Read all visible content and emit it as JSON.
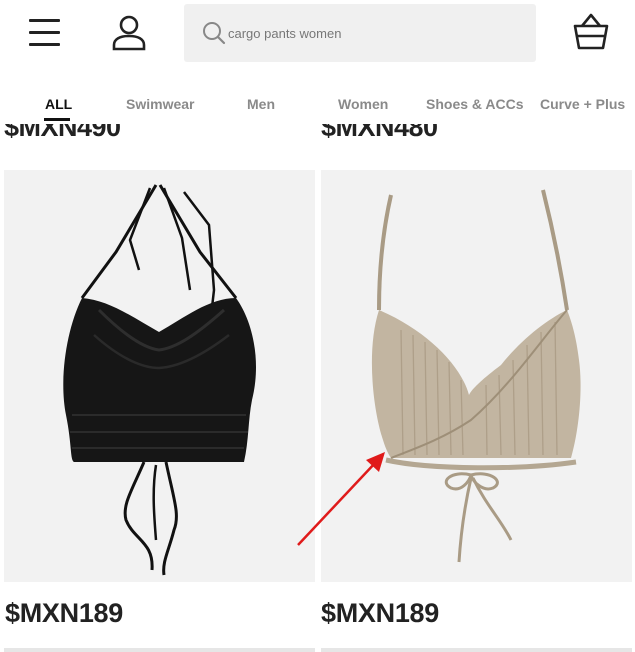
{
  "search": {
    "placeholder": "cargo pants women"
  },
  "tabs": [
    {
      "label": "ALL",
      "active": true
    },
    {
      "label": "Swimwear"
    },
    {
      "label": "Men"
    },
    {
      "label": "Women"
    },
    {
      "label": "Shoes & ACCs"
    },
    {
      "label": "Curve + Plus"
    }
  ],
  "previous_row": {
    "left_price": "$MXN490",
    "right_price": "$MXN480"
  },
  "products": [
    {
      "price": "$MXN189",
      "color": "#111111"
    },
    {
      "price": "$MXN189",
      "color": "#b6a893"
    }
  ],
  "colors": {
    "annotation_arrow": "#e01b1b",
    "text": "#222222",
    "tab_inactive": "#8a8a8a"
  },
  "icons": {
    "menu": "hamburger-icon",
    "account": "user-icon",
    "search": "search-icon",
    "cart": "basket-icon"
  }
}
